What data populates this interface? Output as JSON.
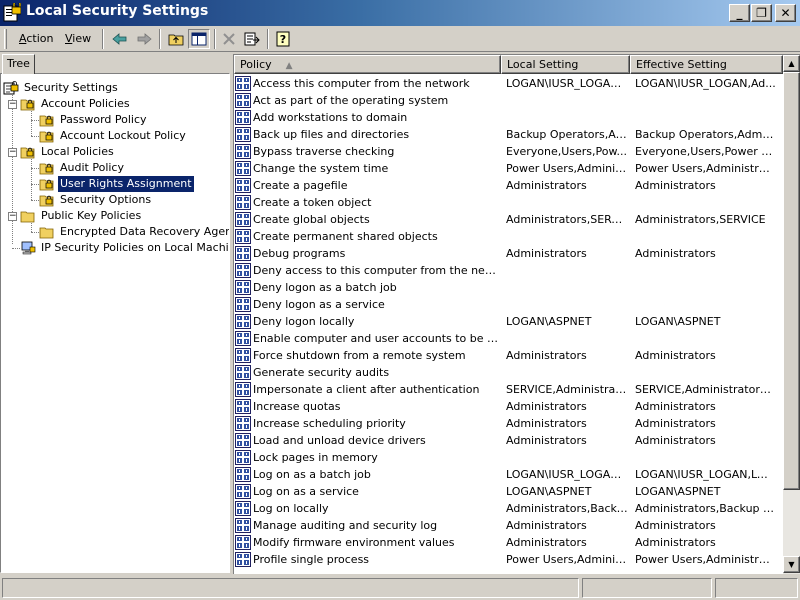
{
  "window": {
    "title": "Local Security Settings",
    "min_glyph": "_",
    "max_glyph": "❐",
    "close_glyph": "✕"
  },
  "menu": {
    "action": {
      "ul": "A",
      "rest": "ction"
    },
    "view": {
      "ul": "V",
      "rest": "iew"
    }
  },
  "toolbar_icons": [
    "back-arrow-icon",
    "forward-arrow-icon",
    "up-one-level-icon",
    "show-hide-tree-icon",
    "delete-icon",
    "export-list-icon",
    "help-icon"
  ],
  "tree": {
    "tab_label": "Tree",
    "items": [
      {
        "label": "Security Settings",
        "icon": "security-settings-icon"
      },
      {
        "label": "Account Policies",
        "icon": "folder-icon",
        "expander": "−"
      },
      {
        "label": "Password Policy",
        "icon": "folder-icon"
      },
      {
        "label": "Account Lockout Policy",
        "icon": "folder-icon"
      },
      {
        "label": "Local Policies",
        "icon": "folder-icon",
        "expander": "−"
      },
      {
        "label": "Audit Policy",
        "icon": "folder-icon"
      },
      {
        "label": "User Rights Assignment",
        "icon": "folder-icon",
        "selected": true
      },
      {
        "label": "Security Options",
        "icon": "folder-icon"
      },
      {
        "label": "Public Key Policies",
        "icon": "folder-icon",
        "expander": "−"
      },
      {
        "label": "Encrypted Data Recovery Agents",
        "icon": "folder-icon"
      },
      {
        "label": "IP Security Policies on Local Machine",
        "icon": "ip-security-icon"
      }
    ]
  },
  "list": {
    "columns": {
      "policy": "Policy",
      "local": "Local Setting",
      "effective": "Effective Setting"
    },
    "sort_glyph": "▲",
    "scroll_up": "▲",
    "scroll_down": "▼",
    "rows": [
      {
        "policy": "Access this computer from the network",
        "local": "LOGAN\\IUSR_LOGAN,...",
        "effective": "LOGAN\\IUSR_LOGAN,Ad..."
      },
      {
        "policy": "Act as part of the operating system",
        "local": "",
        "effective": ""
      },
      {
        "policy": "Add workstations to domain",
        "local": "",
        "effective": ""
      },
      {
        "policy": "Back up files and directories",
        "local": "Backup Operators,Ad...",
        "effective": "Backup Operators,Adminis..."
      },
      {
        "policy": "Bypass traverse checking",
        "local": "Everyone,Users,Pow...",
        "effective": "Everyone,Users,Power Us..."
      },
      {
        "policy": "Change the system time",
        "local": "Power Users,Administ...",
        "effective": "Power Users,Administrators"
      },
      {
        "policy": "Create a pagefile",
        "local": "Administrators",
        "effective": "Administrators"
      },
      {
        "policy": "Create a token object",
        "local": "",
        "effective": ""
      },
      {
        "policy": "Create global objects",
        "local": "Administrators,SERVICE",
        "effective": "Administrators,SERVICE"
      },
      {
        "policy": "Create permanent shared objects",
        "local": "",
        "effective": ""
      },
      {
        "policy": "Debug programs",
        "local": "Administrators",
        "effective": "Administrators"
      },
      {
        "policy": "Deny access to this computer from the network",
        "local": "",
        "effective": ""
      },
      {
        "policy": "Deny logon as a batch job",
        "local": "",
        "effective": ""
      },
      {
        "policy": "Deny logon as a service",
        "local": "",
        "effective": ""
      },
      {
        "policy": "Deny logon locally",
        "local": "LOGAN\\ASPNET",
        "effective": "LOGAN\\ASPNET"
      },
      {
        "policy": "Enable computer and user accounts to be truste...",
        "local": "",
        "effective": ""
      },
      {
        "policy": "Force shutdown from a remote system",
        "local": "Administrators",
        "effective": "Administrators"
      },
      {
        "policy": "Generate security audits",
        "local": "",
        "effective": ""
      },
      {
        "policy": "Impersonate a client after authentication",
        "local": "SERVICE,Administrat...",
        "effective": "SERVICE,Administrators,L..."
      },
      {
        "policy": "Increase quotas",
        "local": "Administrators",
        "effective": "Administrators"
      },
      {
        "policy": "Increase scheduling priority",
        "local": "Administrators",
        "effective": "Administrators"
      },
      {
        "policy": "Load and unload device drivers",
        "local": "Administrators",
        "effective": "Administrators"
      },
      {
        "policy": "Lock pages in memory",
        "local": "",
        "effective": ""
      },
      {
        "policy": "Log on as a batch job",
        "local": "LOGAN\\IUSR_LOGAN...",
        "effective": "LOGAN\\IUSR_LOGAN,LOG..."
      },
      {
        "policy": "Log on as a service",
        "local": "LOGAN\\ASPNET",
        "effective": "LOGAN\\ASPNET"
      },
      {
        "policy": "Log on locally",
        "local": "Administrators,Backu...",
        "effective": "Administrators,Backup Op..."
      },
      {
        "policy": "Manage auditing and security log",
        "local": "Administrators",
        "effective": "Administrators"
      },
      {
        "policy": "Modify firmware environment values",
        "local": "Administrators",
        "effective": "Administrators"
      },
      {
        "policy": "Profile single process",
        "local": "Power Users,Administ...",
        "effective": "Power Users,Administrators"
      }
    ]
  },
  "colors": {
    "title_gradient_start": "#0a246a",
    "title_gradient_end": "#a6caf0",
    "selection": "#0a246a",
    "face": "#d4d0c8"
  }
}
